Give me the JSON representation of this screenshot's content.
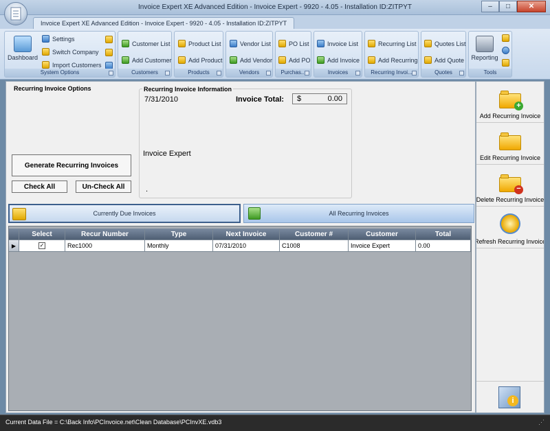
{
  "window": {
    "title": "Invoice Expert XE Advanced Edition - Invoice Expert - 9920 - 4.05 - Installation ID:ZITPYT",
    "minimize": "–",
    "maximize": "□",
    "close": "✕"
  },
  "doc_tab": {
    "label": "Invoice Expert XE Advanced Edition - Invoice Expert - 9920 - 4.05 - Installation ID:ZITPYT"
  },
  "ribbon": {
    "system": {
      "dashboard": "Dashboard",
      "settings": "Settings",
      "switch_company": "Switch Company",
      "import_customers": "Import Customers",
      "label": "System Options"
    },
    "customers": {
      "list": "Customer List",
      "add": "Add Customer",
      "label": "Customers"
    },
    "products": {
      "list": "Product List",
      "add": "Add Product",
      "label": "Products"
    },
    "vendors": {
      "list": "Vendor List",
      "add": "Add Vendor",
      "label": "Vendors"
    },
    "purchase": {
      "list": "PO List",
      "add": "Add PO",
      "label": "Purchas..."
    },
    "invoices": {
      "list": "Invoice List",
      "add": "Add Invoice",
      "label": "Invoices"
    },
    "recurring": {
      "list": "Recurring List",
      "add": "Add Recurring",
      "label": "Recurring Invoi..."
    },
    "quotes": {
      "list": "Quotes List",
      "add": "Add Quote",
      "label": "Quotes"
    },
    "tools": {
      "reporting": "Reporting",
      "label": "Tools"
    }
  },
  "options": {
    "title": "Recurring Invoice Options",
    "generate": "Generate Recurring Invoices",
    "check_all": "Check All",
    "uncheck_all": "Un-Check All"
  },
  "info": {
    "title": "Recurring Invoice Information",
    "date": "7/31/2010",
    "total_label": "Invoice Total:",
    "currency": "$",
    "total_value": "0.00",
    "company": "Invoice Expert",
    "dot": "."
  },
  "tabs": {
    "due": "Currently Due Invoices",
    "all": "All Recurring Invoices"
  },
  "grid": {
    "columns": [
      "Select",
      "Recur Number",
      "Type",
      "Next Invoice",
      "Customer #",
      "Customer",
      "Total"
    ],
    "rows": [
      {
        "selected": true,
        "recur_number": "Rec1000",
        "type": "Monthly",
        "next_invoice": "07/31/2010",
        "customer_no": "C1008",
        "customer": "Invoice Expert",
        "total": "0.00"
      }
    ]
  },
  "sidebar": {
    "add": "Add Recurring Invoice",
    "edit": "Edit Recurring Invoice",
    "delete": "Delete Recurring Invoice",
    "refresh": "Refresh Recurring Invoice"
  },
  "status": {
    "text": "Current Data File = C:\\Back Info\\PCInvoice.net\\Clean Database\\PCInvXE.vdb3"
  },
  "colors": {
    "accent": "#6d8aa6",
    "folder": "#f2b820",
    "header": "#4f5f74"
  }
}
